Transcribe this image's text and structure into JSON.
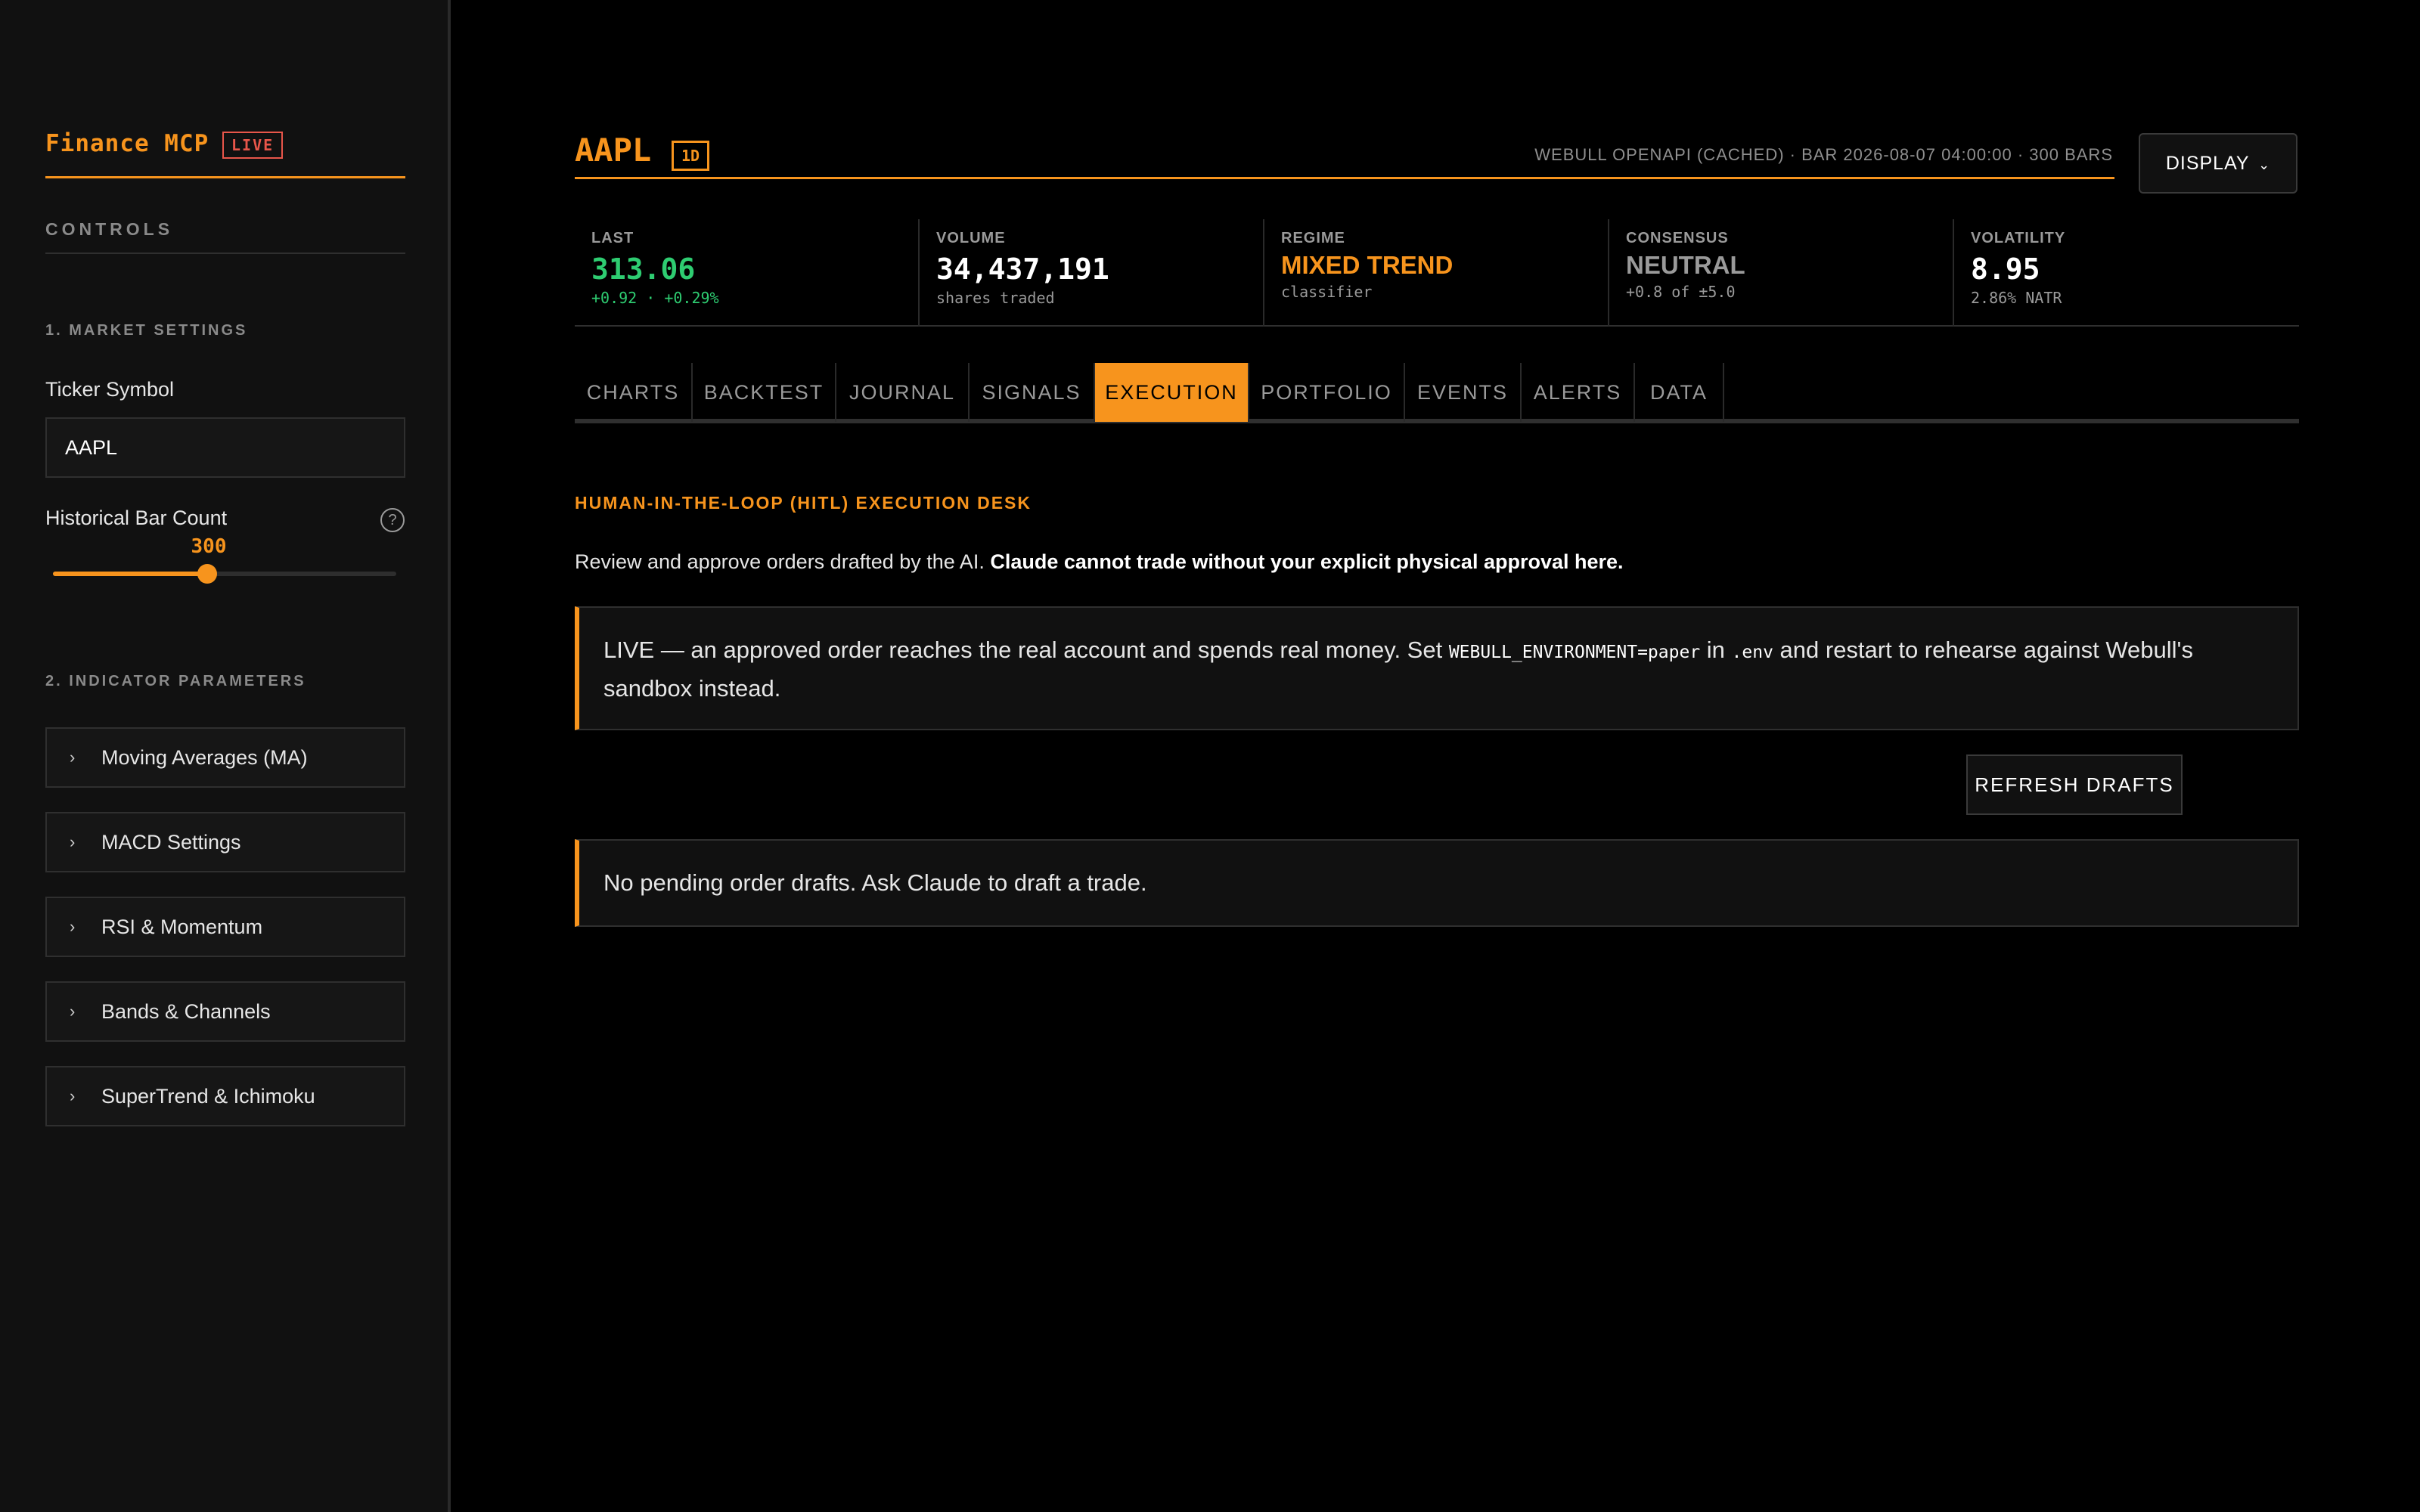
{
  "sidebar": {
    "brand": "Finance MCP",
    "live_badge": "LIVE",
    "controls_title": "CONTROLS",
    "market_settings_title": "1. MARKET SETTINGS",
    "ticker_label": "Ticker Symbol",
    "ticker_value": "AAPL",
    "bar_count_label": "Historical Bar Count",
    "bar_count_value": "300",
    "bar_count_fraction": 0.45,
    "help_glyph": "?",
    "indicator_title": "2. INDICATOR PARAMETERS",
    "accordions": [
      {
        "label": "Moving Averages (MA)",
        "icon": "chevron-right-icon"
      },
      {
        "label": "MACD Settings",
        "icon": "chevron-right-icon"
      },
      {
        "label": "RSI & Momentum",
        "icon": "chevron-right-icon"
      },
      {
        "label": "Bands & Channels",
        "icon": "chevron-right-icon"
      },
      {
        "label": "SuperTrend & Ichimoku",
        "icon": "chevron-right-icon"
      }
    ]
  },
  "header": {
    "ticker": "AAPL",
    "timeframe": "1D",
    "source": "WEBULL OPENAPI (CACHED) · BAR 2026-08-07 04:00:00 · 300 BARS",
    "display_label": "DISPLAY",
    "display_icon": "chevron-down-icon"
  },
  "stats": [
    {
      "label": "LAST",
      "value": "313.06",
      "sub": "+0.92 · +0.29%",
      "value_color": "#2ecc71",
      "sub_color": "#2ecc71"
    },
    {
      "label": "VOLUME",
      "value": "34,437,191",
      "sub": "shares traded",
      "value_color": "#ffffff",
      "sub_color": "#9a9a9a"
    },
    {
      "label": "REGIME",
      "value": "MIXED TREND",
      "sub": "classifier",
      "value_color": "#f7941d",
      "sub_color": "#9a9a9a"
    },
    {
      "label": "CONSENSUS",
      "value": "NEUTRAL",
      "sub": "+0.8 of ±5.0",
      "value_color": "#9a9a9a",
      "sub_color": "#9a9a9a"
    },
    {
      "label": "VOLATILITY",
      "value": "8.95",
      "sub": "2.86% NATR",
      "value_color": "#ffffff",
      "sub_color": "#9a9a9a"
    }
  ],
  "tabs": [
    "CHARTS",
    "BACKTEST",
    "JOURNAL",
    "SIGNALS",
    "EXECUTION",
    "PORTFOLIO",
    "EVENTS",
    "ALERTS",
    "DATA"
  ],
  "active_tab": "EXECUTION",
  "execution": {
    "title": "HUMAN-IN-THE-LOOP (HITL) EXECUTION DESK",
    "desc_plain": "Review and approve orders drafted by the AI. ",
    "desc_bold": "Claude cannot trade without your explicit physical approval here.",
    "warn_part1": "LIVE — an approved order reaches the real account and spends real money. Set ",
    "warn_code1": "WEBULL_ENVIRONMENT=paper",
    "warn_part2": " in ",
    "warn_code2": ".env",
    "warn_part3": " and restart to rehearse against Webull's sandbox instead.",
    "refresh_label": "REFRESH DRAFTS",
    "empty_message": "No pending order drafts. Ask Claude to draft a trade."
  },
  "colors": {
    "accent": "#f7941d",
    "positive": "#2ecc71",
    "live": "#e8564a",
    "background": "#000000",
    "panel": "#111111"
  }
}
